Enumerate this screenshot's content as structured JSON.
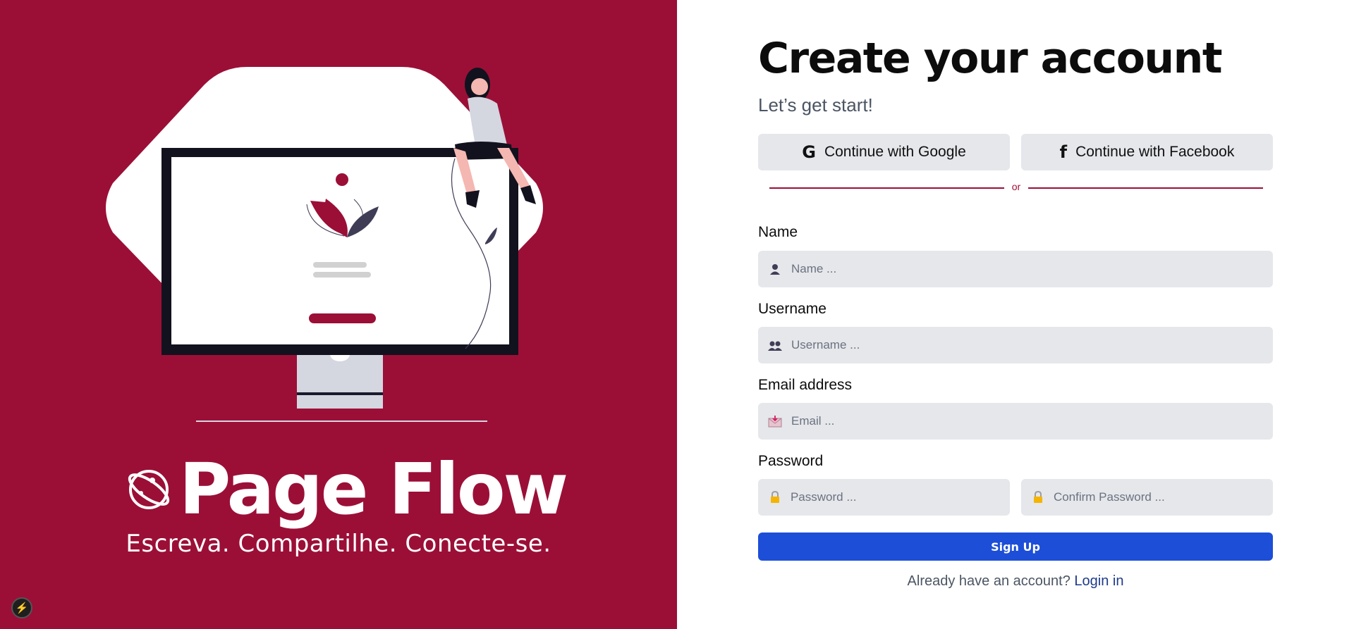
{
  "hero": {
    "brand_name": "Page Flow",
    "tagline": "Escreva. Compartilhe. Conecte-se.",
    "illustration_icon": "computer-with-woman-illustration",
    "logo_icon": "planet-logo-icon",
    "bg_color": "#9b0f37"
  },
  "form": {
    "title": "Create your account",
    "subtitle": "Let’s get start!",
    "google_label": "Continue with Google",
    "facebook_label": "Continue with Facebook",
    "divider_text": "or",
    "name": {
      "label": "Name",
      "placeholder": "Name ...",
      "icon": "person-icon"
    },
    "username": {
      "label": "Username",
      "placeholder": "Username ...",
      "icon": "people-icon"
    },
    "email": {
      "label": "Email address",
      "placeholder": "Email ...",
      "icon": "envelope-icon"
    },
    "password": {
      "label": "Password",
      "placeholder": "Password ...",
      "confirm_placeholder": "Confirm Password ...",
      "icon": "lock-icon"
    },
    "signup_label": "Sign Up",
    "login_prompt": "Already have an account?",
    "login_link": "Login in",
    "accent_color": "#1d4ed8"
  },
  "devtools_icon": "lightning-bolt-icon"
}
